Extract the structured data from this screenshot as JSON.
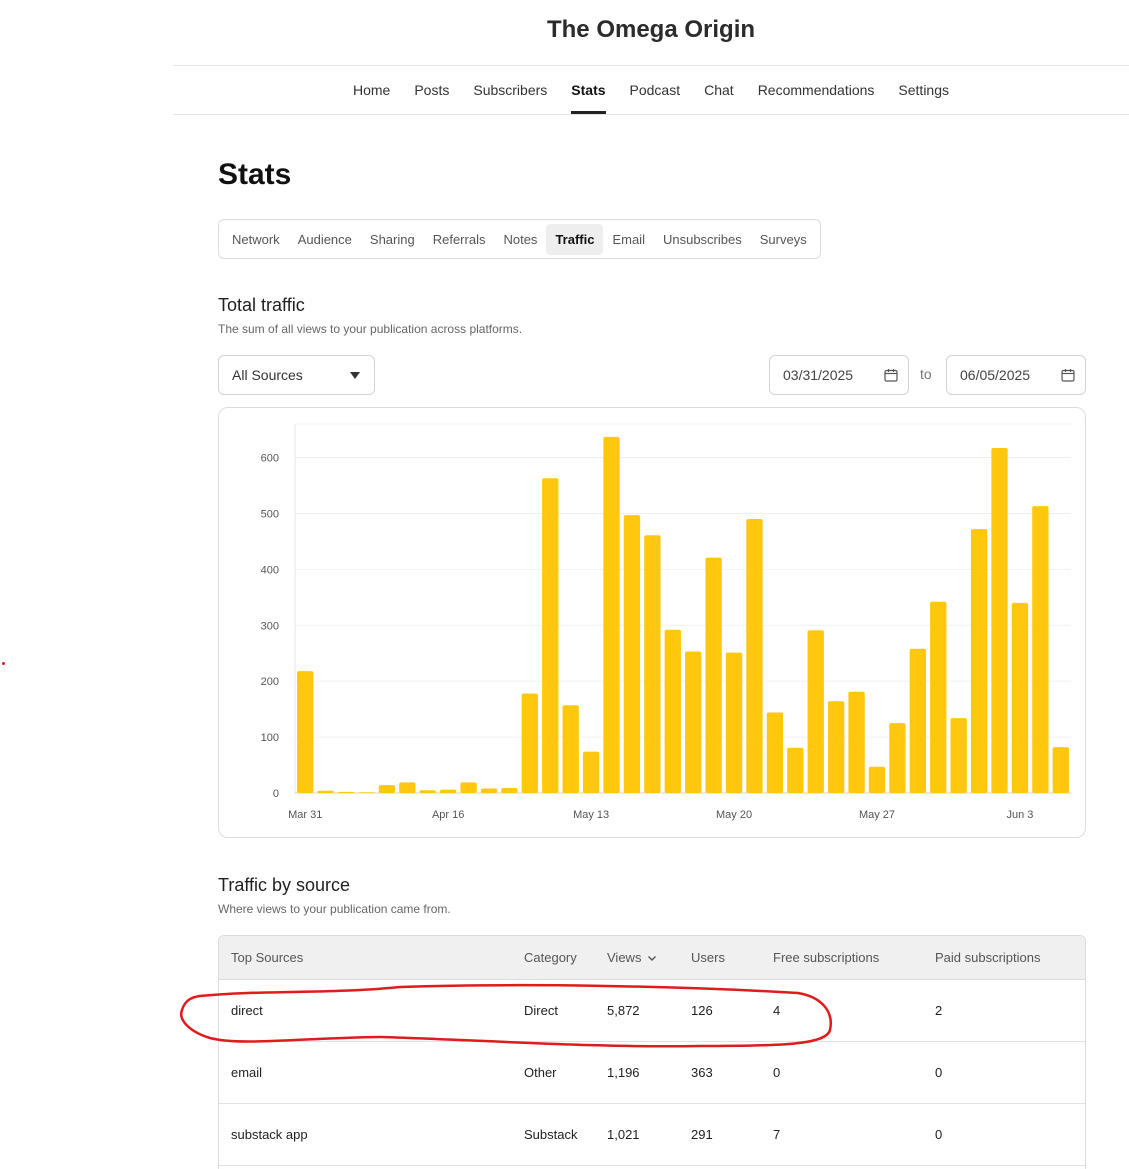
{
  "publication": {
    "title": "The Omega Origin"
  },
  "nav": {
    "items": [
      "Home",
      "Posts",
      "Subscribers",
      "Stats",
      "Podcast",
      "Chat",
      "Recommendations",
      "Settings"
    ],
    "active": "Stats"
  },
  "page": {
    "title": "Stats"
  },
  "subtabs": {
    "items": [
      "Network",
      "Audience",
      "Sharing",
      "Referrals",
      "Notes",
      "Traffic",
      "Email",
      "Unsubscribes",
      "Surveys"
    ],
    "active": "Traffic"
  },
  "total_traffic": {
    "title": "Total traffic",
    "subtitle": "The sum of all views to your publication across platforms.",
    "source_filter": "All Sources",
    "date_from": "03/31/2025",
    "to_label": "to",
    "date_to": "06/05/2025"
  },
  "chart_data": {
    "type": "bar",
    "title": "",
    "xlabel": "",
    "ylabel": "",
    "ylim": [
      0,
      660
    ],
    "yticks": [
      0,
      100,
      200,
      300,
      400,
      500,
      600
    ],
    "grid": true,
    "xtick_labels": [
      {
        "index": 0,
        "label": "Mar 31"
      },
      {
        "index": 7,
        "label": "Apr 16"
      },
      {
        "index": 14,
        "label": "May 13"
      },
      {
        "index": 21,
        "label": "May 20"
      },
      {
        "index": 28,
        "label": "May 27"
      },
      {
        "index": 35,
        "label": "Jun 3"
      }
    ],
    "values": [
      218,
      4,
      2,
      1,
      14,
      19,
      5,
      6,
      19,
      8,
      9,
      178,
      563,
      157,
      74,
      637,
      497,
      461,
      292,
      253,
      421,
      251,
      490,
      144,
      81,
      291,
      164,
      181,
      47,
      125,
      258,
      342,
      134,
      472,
      617,
      340,
      513,
      82
    ],
    "color": "#FFC80F"
  },
  "traffic_by_source": {
    "title": "Traffic by source",
    "subtitle": "Where views to your publication came from.",
    "columns": [
      "Top Sources",
      "Category",
      "Views",
      "Users",
      "Free subscriptions",
      "Paid subscriptions"
    ],
    "rows": [
      [
        "direct",
        "Direct",
        "5,872",
        "126",
        "4",
        "2"
      ],
      [
        "email",
        "Other",
        "1,196",
        "363",
        "0",
        "0"
      ],
      [
        "substack app",
        "Substack",
        "1,021",
        "291",
        "7",
        "0"
      ]
    ]
  },
  "colors": {
    "accent": "#FFC80F",
    "annotation": "#E01B1B"
  }
}
